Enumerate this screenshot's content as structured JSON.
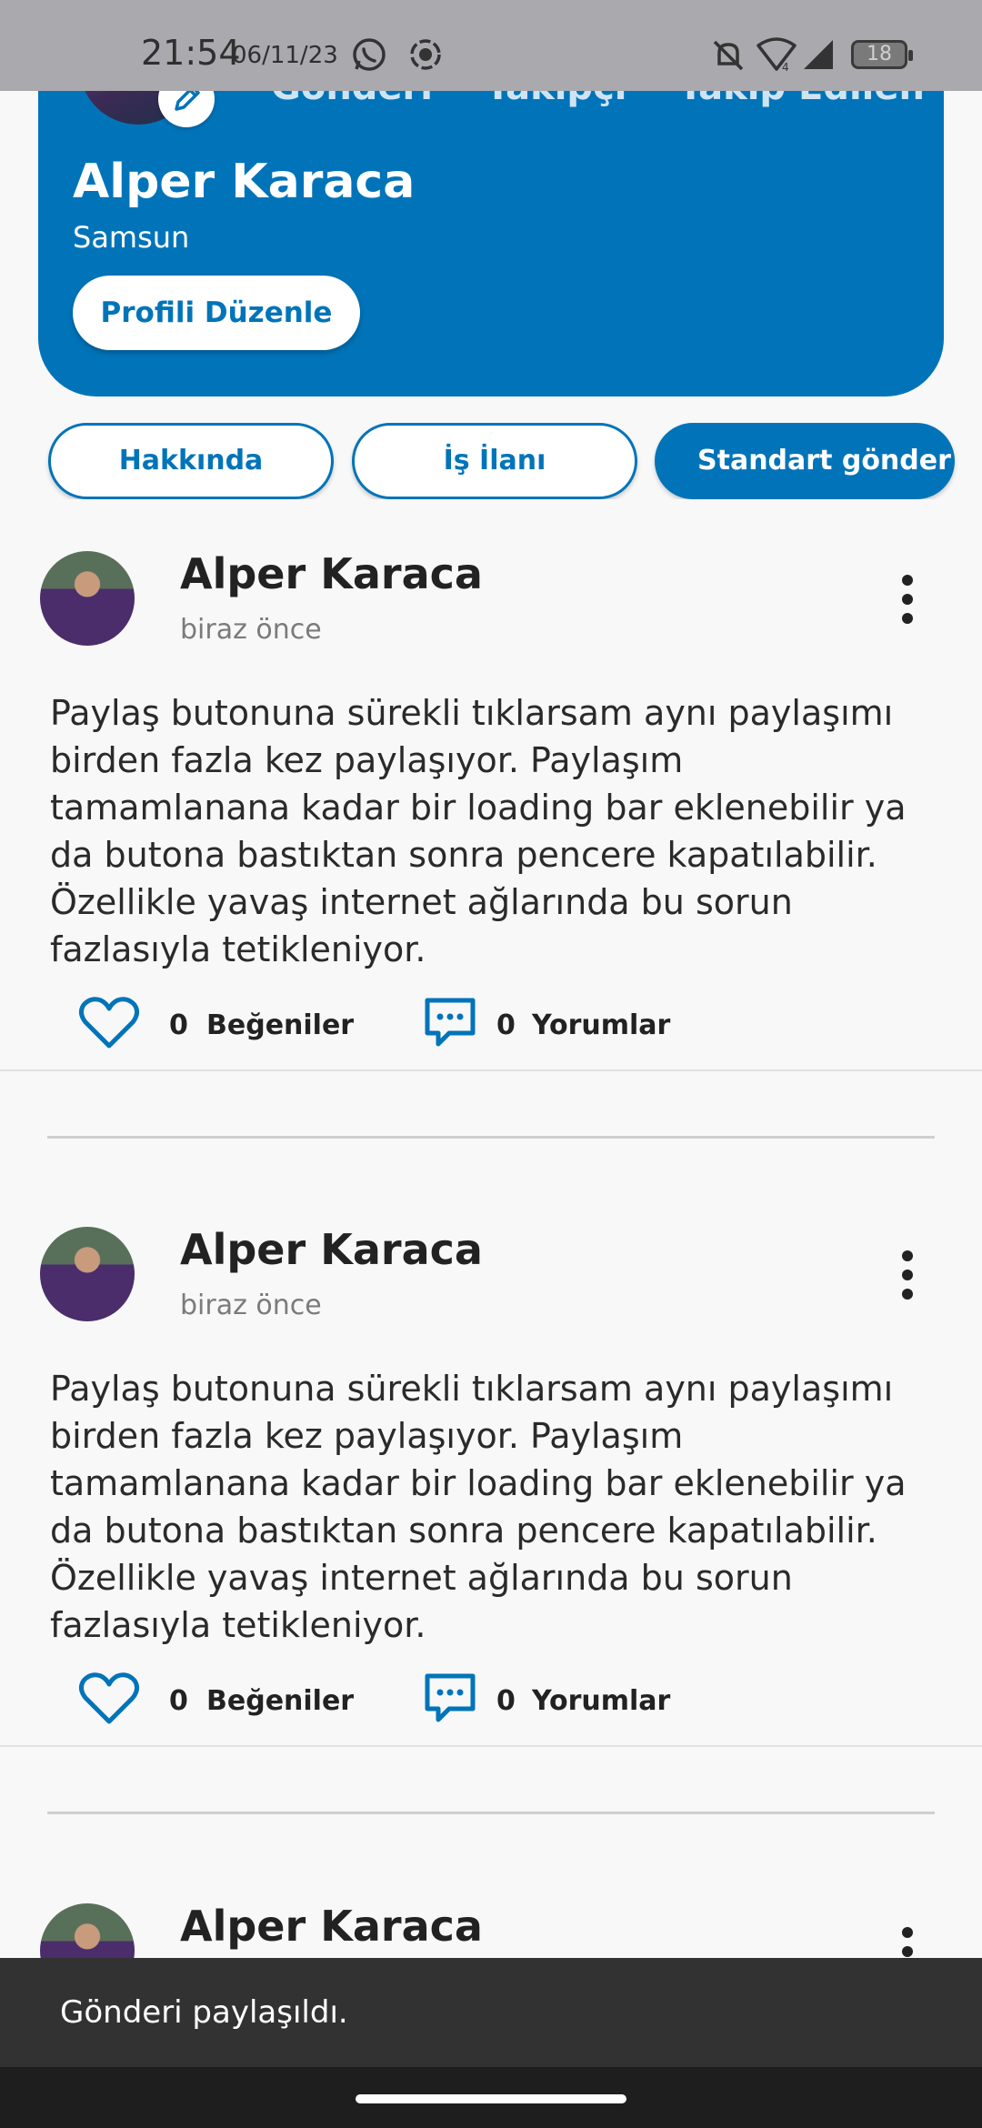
{
  "status_bar": {
    "time": "21:54",
    "date": "06/11/23",
    "battery": "18",
    "icons": [
      "whatsapp-icon",
      "screen-record-icon",
      "mute-icon",
      "wifi-icon",
      "signal-icon",
      "battery-icon"
    ]
  },
  "profile": {
    "name": "Alper Karaca",
    "city": "Samsun",
    "edit_button": "Profili Düzenle",
    "stats_peek": [
      "Gönderi",
      "Takipçi",
      "Takip Edilen"
    ]
  },
  "tabs": [
    {
      "label": "Hakkında",
      "active": false
    },
    {
      "label": "İş İlanı",
      "active": false
    },
    {
      "label": "Standart gönderi",
      "active": true
    }
  ],
  "posts": [
    {
      "author": "Alper Karaca",
      "time": "biraz önce",
      "text": "Paylaş butonuna sürekli tıklarsam aynı paylaşımı birden fazla kez paylaşıyor. Paylaşım tamamlanana kadar bir loading bar eklenebilir ya da butona bastıktan sonra pencere kapatılabilir. Özellikle yavaş internet ağlarında bu sorun fazlasıyla tetikleniyor.",
      "likes": "0",
      "likes_label": "Beğeniler",
      "comments": "0",
      "comments_label": "Yorumlar"
    },
    {
      "author": "Alper Karaca",
      "time": "biraz önce",
      "text": "Paylaş butonuna sürekli tıklarsam aynı paylaşımı birden fazla kez paylaşıyor. Paylaşım tamamlanana kadar bir loading bar eklenebilir ya da butona bastıktan sonra pencere kapatılabilir. Özellikle yavaş internet ağlarında bu sorun fazlasıyla tetikleniyor.",
      "likes": "0",
      "likes_label": "Beğeniler",
      "comments": "0",
      "comments_label": "Yorumlar"
    },
    {
      "author": "Alper Karaca"
    }
  ],
  "snackbar": {
    "message": "Gönderi paylaşıldı."
  },
  "colors": {
    "primary": "#0174b9",
    "background": "#f8f8f8",
    "snackbar": "#323232"
  }
}
